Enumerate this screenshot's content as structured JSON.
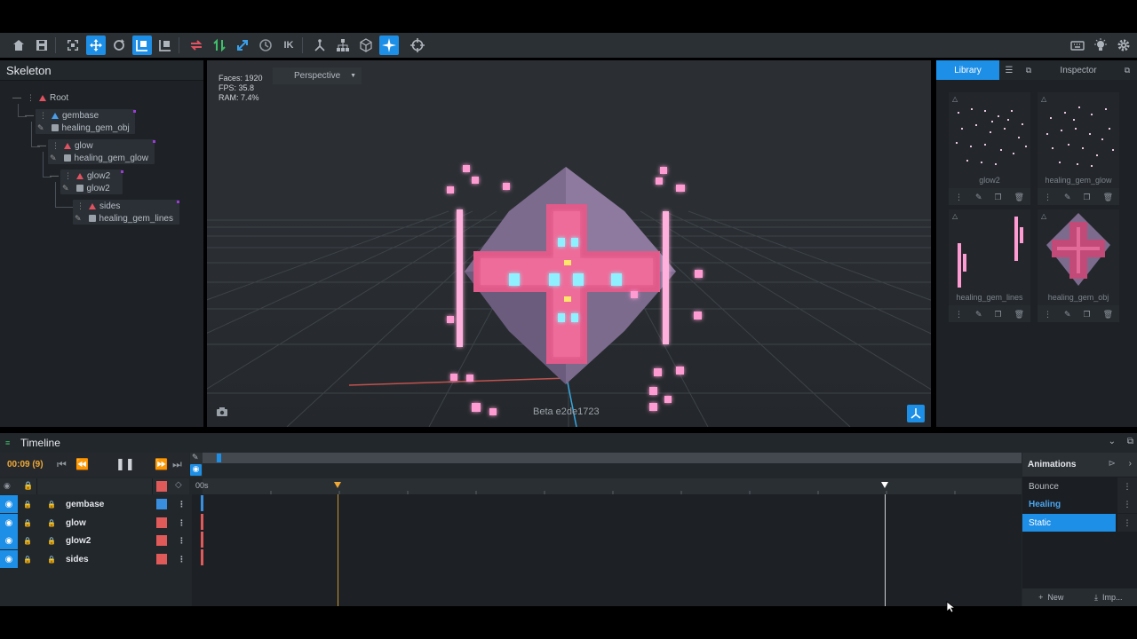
{
  "toolbar": {
    "ik_label": "IK"
  },
  "skeleton": {
    "title": "Skeleton",
    "nodes": [
      {
        "label": "Root"
      },
      {
        "label": "gembase"
      },
      {
        "label": "healing_gem_obj"
      },
      {
        "label": "glow"
      },
      {
        "label": "healing_gem_glow"
      },
      {
        "label": "glow2"
      },
      {
        "label": "glow2"
      },
      {
        "label": "sides"
      },
      {
        "label": "healing_gem_lines"
      }
    ]
  },
  "viewport": {
    "faces": "Faces: 1920",
    "fps": "FPS: 35.8",
    "ram": "RAM: 7.4%",
    "camera_mode": "Perspective",
    "version": "Beta e2de1723"
  },
  "library": {
    "tab_library": "Library",
    "tab_inspector": "Inspector",
    "items": [
      {
        "name": "glow2"
      },
      {
        "name": "healing_gem_glow"
      },
      {
        "name": "healing_gem_lines"
      },
      {
        "name": "healing_gem_obj"
      }
    ]
  },
  "timeline": {
    "title": "Timeline",
    "timecode": "00:09 (9)",
    "ruler_start": "00s",
    "tracks": [
      {
        "name": "gembase",
        "color": "#3a8ee0"
      },
      {
        "name": "glow",
        "color": "#e05a5a"
      },
      {
        "name": "glow2",
        "color": "#e05a5a"
      },
      {
        "name": "sides",
        "color": "#e05a5a"
      }
    ],
    "animations_title": "Animations",
    "animations": [
      {
        "name": "Bounce"
      },
      {
        "name": "Healing"
      },
      {
        "name": "Static"
      }
    ],
    "new_label": "New",
    "import_label": "Imp..."
  },
  "colors": {
    "accent": "#1e8fe6",
    "keyframe": "#f0a936",
    "gem": "#f06a9a"
  }
}
